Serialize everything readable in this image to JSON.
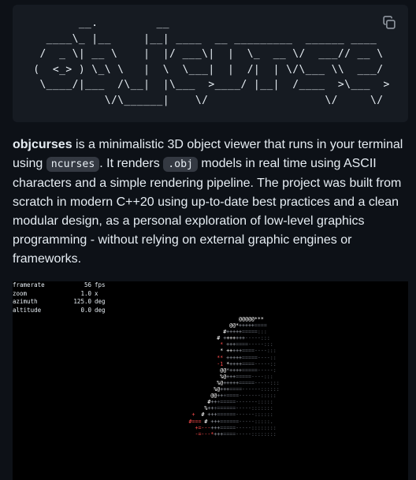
{
  "banner": {
    "ascii_art": "        __.         __\n   ____\\_ |__     |__| ____  __ _________  ______ ____\n  /  _ \\| __ \\    |  |/ ___\\|  |  \\_  __ \\/  ___// __ \\\n (  <_> ) \\_\\ \\   |  \\  \\___|  |  /|  | \\/\\___ \\\\  ___/\n  \\____/|___  /\\__|  |\\___  >____/ |__|  /____  >\\___  >\n            \\/\\______|    \\/                  \\/     \\/",
    "copy_icon": "copy-icon"
  },
  "description": {
    "project_name": "objcurses",
    "part1": " is a minimalistic 3D object viewer that runs in your terminal using ",
    "code1": "ncurses",
    "part2": ". It renders ",
    "code2": ".obj",
    "part3": " models in real time using ASCII characters and a simple rendering pipeline. The project was built from scratch in modern C++20 using up-to-date best practices and a clean modular design, as a personal exploration of low-level graphics programming - without relying on external graphic engines or frameworks."
  },
  "demo": {
    "stats": [
      {
        "label": "framerate",
        "value": "56",
        "unit": "fps"
      },
      {
        "label": "zoom",
        "value": "1.0",
        "unit": "x"
      },
      {
        "label": "azimuth",
        "value": "125.0",
        "unit": "deg"
      },
      {
        "label": "altitude",
        "value": "0.0",
        "unit": "deg"
      }
    ]
  }
}
